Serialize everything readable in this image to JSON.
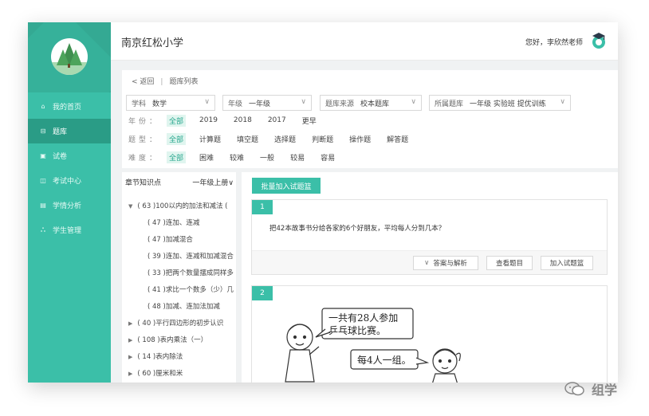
{
  "school_name": "南京红松小学",
  "greeting": "您好，李欣然老师",
  "nav": [
    {
      "icon": "home-icon",
      "glyph": "⌂",
      "label": "我的首页",
      "active": false
    },
    {
      "icon": "bookmark-icon",
      "glyph": "⊟",
      "label": "题库",
      "active": true
    },
    {
      "icon": "book-icon",
      "glyph": "▣",
      "label": "试卷",
      "active": false
    },
    {
      "icon": "exam-icon",
      "glyph": "◫",
      "label": "考试中心",
      "active": false
    },
    {
      "icon": "analytics-icon",
      "glyph": "▤",
      "label": "学情分析",
      "active": false
    },
    {
      "icon": "users-icon",
      "glyph": "ஃ",
      "label": "学生管理",
      "active": false
    }
  ],
  "breadcrumb": {
    "back": "< 返回",
    "current": "题库列表"
  },
  "selects": [
    {
      "label": "学科",
      "value": "数学"
    },
    {
      "label": "年级",
      "value": "一年级"
    },
    {
      "label": "题库来源",
      "value": "校本题库"
    },
    {
      "label": "所属题库",
      "value": "一年级 实验班 提优训练"
    }
  ],
  "filters": [
    {
      "label": "年份：",
      "options": [
        "全部",
        "2019",
        "2018",
        "2017",
        "更早"
      ],
      "selected": 0
    },
    {
      "label": "题型：",
      "options": [
        "全部",
        "计算题",
        "填空题",
        "选择题",
        "判断题",
        "操作题",
        "解答题"
      ],
      "selected": 0
    },
    {
      "label": "难度：",
      "options": [
        "全部",
        "困难",
        "较难",
        "一般",
        "较易",
        "容易"
      ],
      "selected": 0
    }
  ],
  "tree": {
    "header": "章节知识点",
    "grade": "一年级上册∨",
    "items": [
      {
        "text": "( 63 )100以内的加法和减法 (",
        "level": 0,
        "expanded": true
      },
      {
        "text": "( 47 )连加、连减",
        "level": 1
      },
      {
        "text": "( 47 )加减混合",
        "level": 1
      },
      {
        "text": "( 39 )连加、连减和加减混合",
        "level": 1
      },
      {
        "text": "( 33 )把两个数量摆成同样多",
        "level": 1
      },
      {
        "text": "( 41 )求比一个数多（少）几",
        "level": 1
      },
      {
        "text": "( 48 )加减、连加法加减",
        "level": 1
      },
      {
        "text": "( 40 )平行四边形的初步认识",
        "level": 0,
        "expanded": false
      },
      {
        "text": "( 108 )表内乘法（一）",
        "level": 0,
        "expanded": false
      },
      {
        "text": "( 14 )表内除法",
        "level": 0,
        "expanded": false
      },
      {
        "text": "( 60 )厘米和米",
        "level": 0,
        "expanded": false
      }
    ]
  },
  "batch_button": "批量加入试题篮",
  "questions": [
    {
      "number": "1",
      "text": "把42本故事书分给各家的6个好朋友，平均每人分到几本？",
      "actions": [
        "答案与解析",
        "查看题目",
        "加入试题篮"
      ]
    },
    {
      "number": "2",
      "bubble1": "一共有28人参加乒乓球比赛。",
      "bubble1_line1": "一共有28人参加",
      "bubble1_line2": "乒乓球比赛。",
      "bubble2": "每4人一组。"
    }
  ],
  "watermark": "组学",
  "colors": {
    "accent": "#3bbfa8",
    "accent_dark": "#2a9c86"
  }
}
